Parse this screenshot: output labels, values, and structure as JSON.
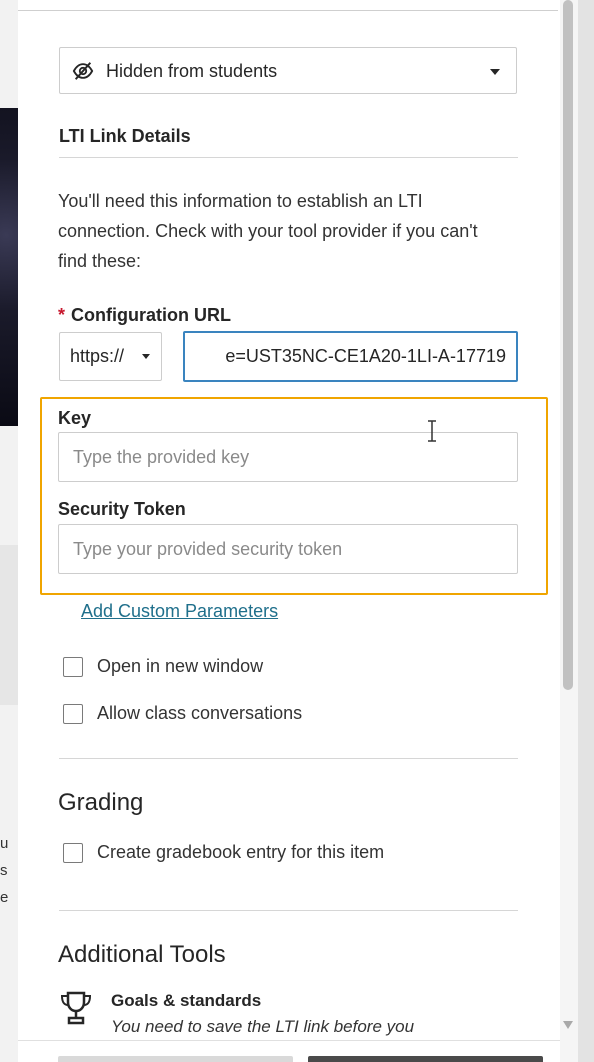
{
  "visibility": {
    "label": "Hidden from students",
    "icon": "eye-slash-icon"
  },
  "lti": {
    "section_title": "LTI Link Details",
    "description": "You'll need this information to establish an LTI connection. Check with your tool provider if you can't find these:",
    "config_url": {
      "required_marker": "*",
      "label": "Configuration URL",
      "protocol": "https://",
      "value": "e=UST35NC-CE1A20-1LI-A-17719"
    },
    "key": {
      "label": "Key",
      "placeholder": "Type the provided key",
      "value": ""
    },
    "token": {
      "label": "Security Token",
      "placeholder": "Type your provided security token",
      "value": ""
    },
    "custom_params_link": "Add Custom Parameters",
    "open_new_window": "Open in new window",
    "allow_conversations": "Allow class conversations"
  },
  "grading": {
    "title": "Grading",
    "gradebook_entry": "Create gradebook entry for this item"
  },
  "additional_tools": {
    "title": "Additional Tools",
    "goals": {
      "icon": "trophy-icon",
      "title": "Goals & standards",
      "subtitle": "You need to save the LTI link before you"
    }
  },
  "background": {
    "letters": [
      "u",
      "s",
      "e"
    ]
  },
  "colors": {
    "highlight": "#f0a500",
    "required": "#c7182e",
    "link": "#1f6f8b",
    "focus": "#3a84bf"
  }
}
